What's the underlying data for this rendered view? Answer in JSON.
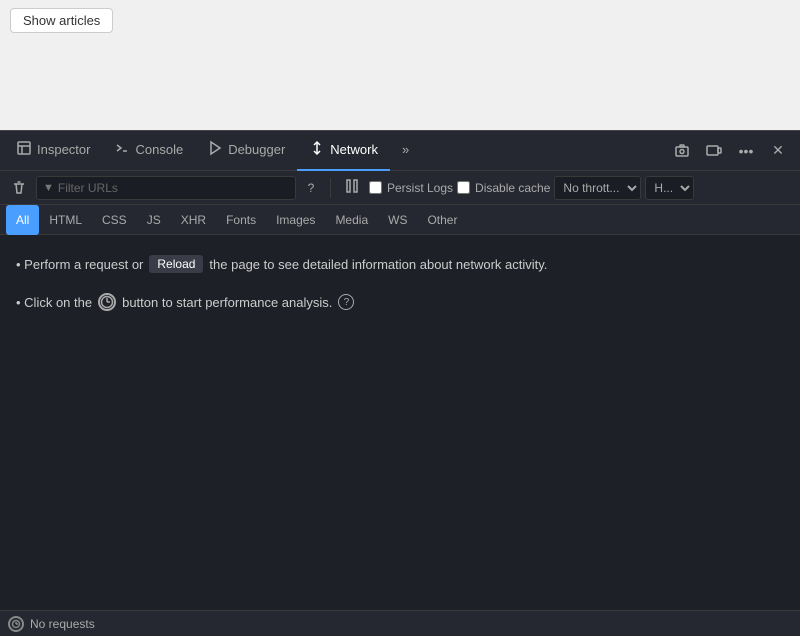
{
  "browser": {
    "show_articles_label": "Show articles"
  },
  "devtools": {
    "tabs": [
      {
        "id": "inspector",
        "label": "Inspector",
        "icon": "⬜",
        "active": false
      },
      {
        "id": "console",
        "label": "Console",
        "icon": "⬛",
        "active": false
      },
      {
        "id": "debugger",
        "label": "Debugger",
        "icon": "▷",
        "active": false
      },
      {
        "id": "network",
        "label": "Network",
        "icon": "⇅",
        "active": true
      },
      {
        "id": "more",
        "label": "»",
        "icon": "",
        "active": false
      }
    ],
    "toolbar": {
      "filter_placeholder": "Filter URLs",
      "persist_logs_label": "Persist Logs",
      "disable_cache_label": "Disable cache",
      "throttle_option": "No thrott...",
      "h_option": "H..."
    },
    "filter_tabs": [
      {
        "id": "all",
        "label": "All",
        "active": true
      },
      {
        "id": "html",
        "label": "HTML",
        "active": false
      },
      {
        "id": "css",
        "label": "CSS",
        "active": false
      },
      {
        "id": "js",
        "label": "JS",
        "active": false
      },
      {
        "id": "xhr",
        "label": "XHR",
        "active": false
      },
      {
        "id": "fonts",
        "label": "Fonts",
        "active": false
      },
      {
        "id": "images",
        "label": "Images",
        "active": false
      },
      {
        "id": "media",
        "label": "Media",
        "active": false
      },
      {
        "id": "ws",
        "label": "WS",
        "active": false
      },
      {
        "id": "other",
        "label": "Other",
        "active": false
      }
    ],
    "main": {
      "line1_prefix": "• Perform a request or",
      "line1_reload": "Reload",
      "line1_suffix": "the page to see detailed information about network activity.",
      "line2_prefix": "• Click on the",
      "line2_suffix": "button to start performance analysis."
    },
    "status": {
      "text": "No requests"
    }
  }
}
